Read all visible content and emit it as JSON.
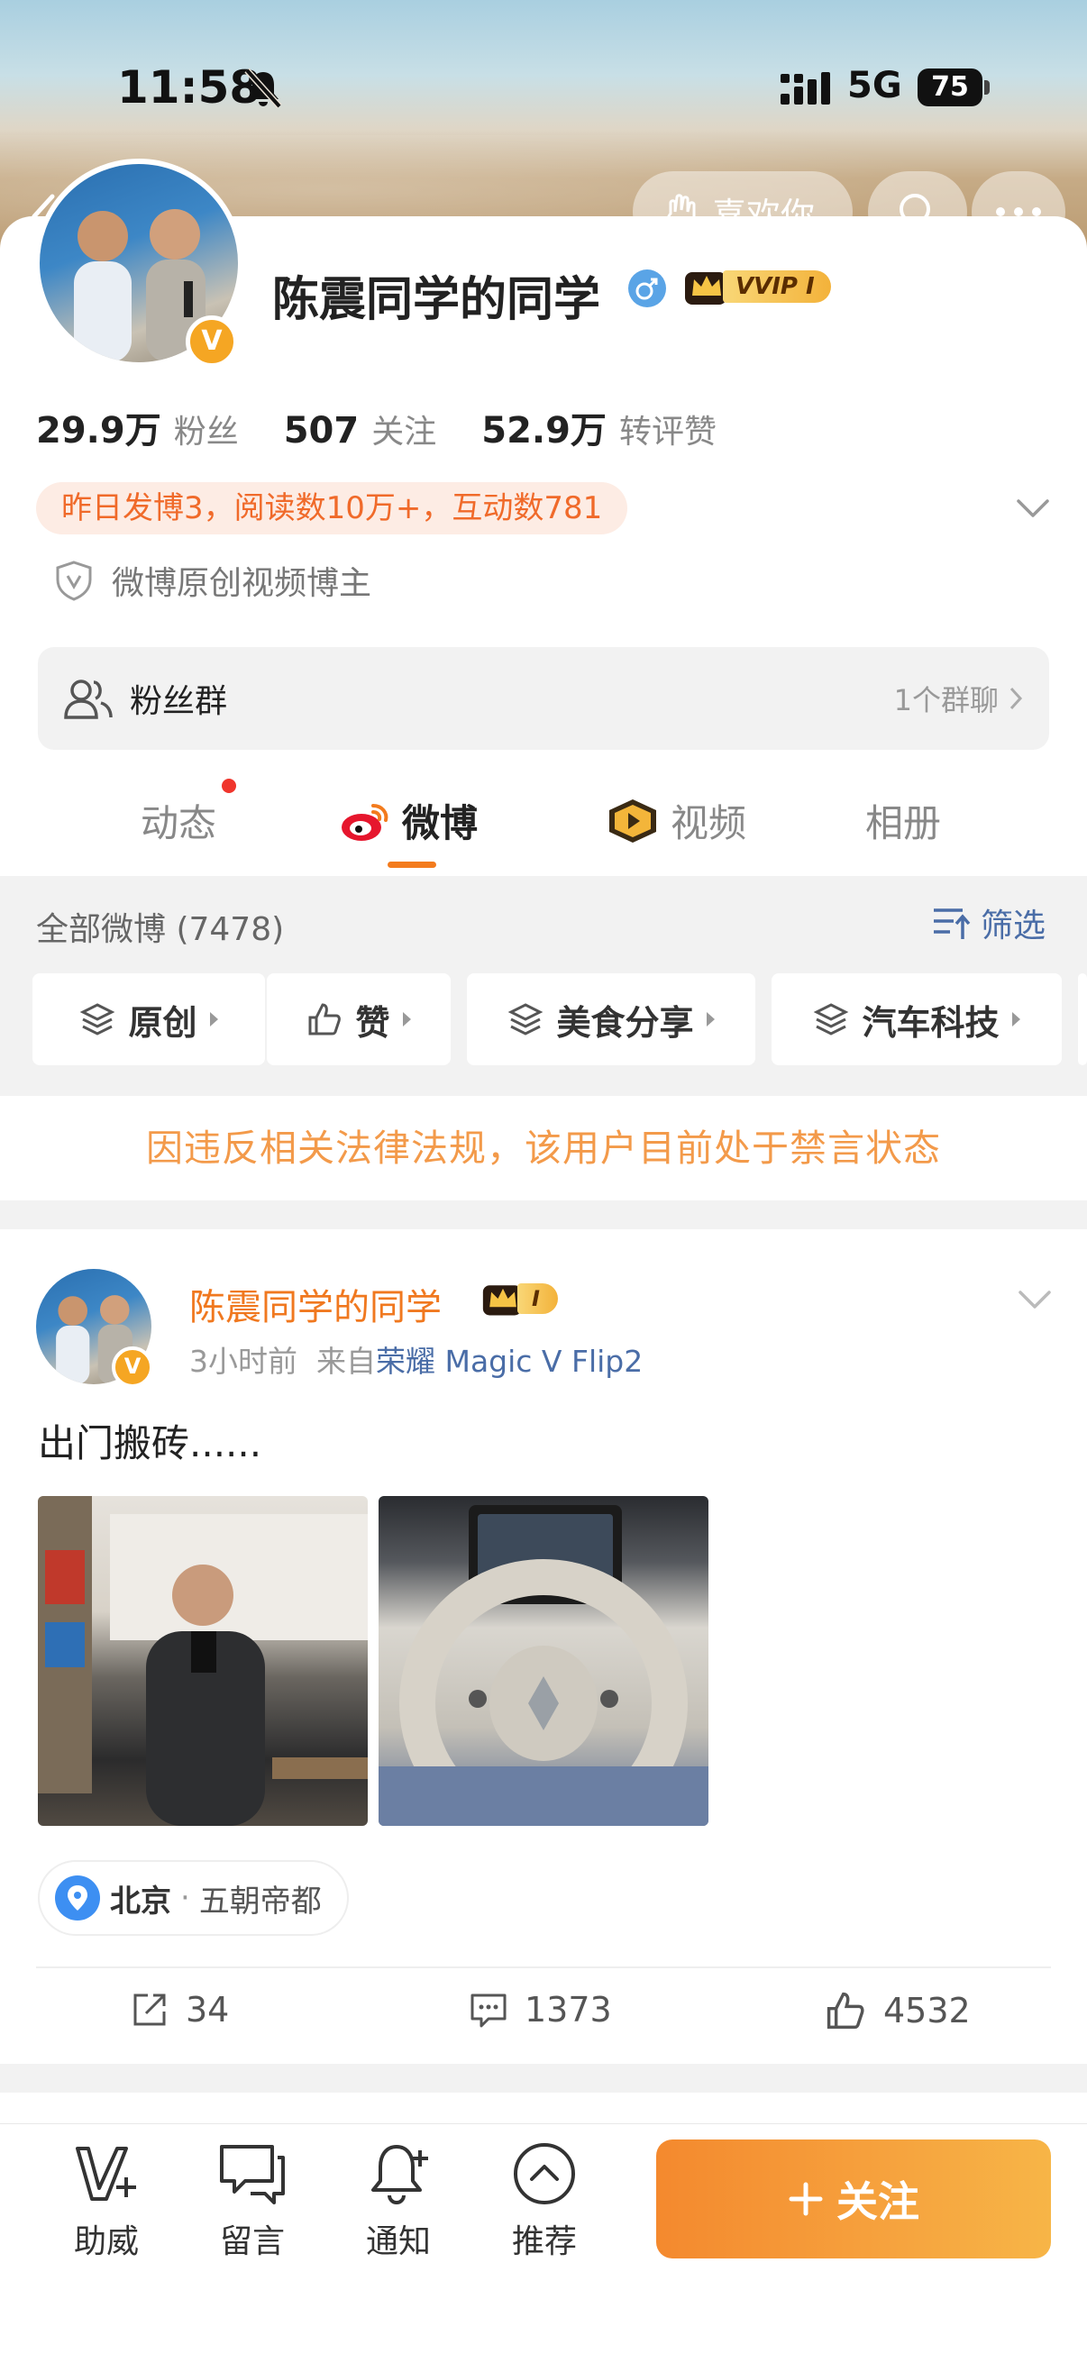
{
  "status_bar": {
    "time": "11:58",
    "network": "5G",
    "battery": "75"
  },
  "header": {
    "like_label": "喜欢你"
  },
  "profile": {
    "name": "陈震同学的同学",
    "vip_label": "VVIP I",
    "verified_badge": "V",
    "stats": [
      {
        "value": "29.9万",
        "label": "粉丝"
      },
      {
        "value": "507",
        "label": "关注"
      },
      {
        "value": "52.9万",
        "label": "转评赞"
      }
    ],
    "summary": "昨日发博3，阅读数10万+，互动数781",
    "certification": "微博原创视频博主",
    "fans_group": {
      "label": "粉丝群",
      "count": "1个群聊"
    }
  },
  "tabs": [
    {
      "label": "动态"
    },
    {
      "label": "微博"
    },
    {
      "label": "视频"
    },
    {
      "label": "相册"
    }
  ],
  "feed": {
    "all_count": "全部微博 (7478)",
    "filter_label": "筛选",
    "chips": [
      "原创",
      "赞",
      "美食分享",
      "汽车科技"
    ],
    "banned_notice": "因违反相关法律法规，该用户目前处于禁言状态"
  },
  "post": {
    "author": "陈震同学的同学",
    "vip_label": "I",
    "time": "3小时前",
    "source_prefix": "来自",
    "device": "荣耀 Magic V Flip2",
    "text": "出门搬砖......",
    "location": {
      "city": "北京",
      "separator": "·",
      "area": "五朝帝都"
    },
    "actions": {
      "reposts": "34",
      "comments": "1373",
      "likes": "4532"
    }
  },
  "bottom_bar": {
    "items": [
      "助威",
      "留言",
      "通知",
      "推荐"
    ],
    "follow_label": "关注"
  },
  "colors": {
    "accent": "#f37b1d",
    "link": "#4a6da7",
    "follow_gradient_start": "#f4892e",
    "follow_gradient_end": "#f7b547"
  }
}
